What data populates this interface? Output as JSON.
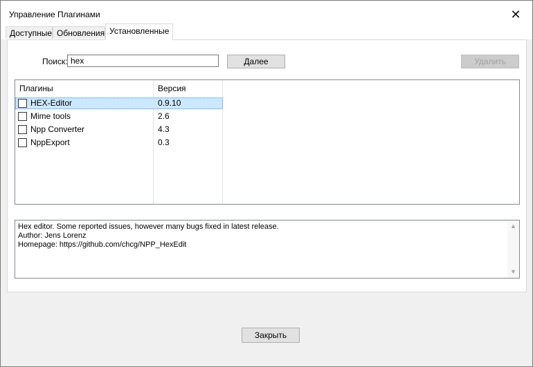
{
  "window": {
    "title": "Управление Плагинами",
    "close_glyph": "✕"
  },
  "tabs": [
    {
      "label": "Доступные",
      "active": false
    },
    {
      "label": "Обновления",
      "active": false
    },
    {
      "label": "Установленные",
      "active": true
    }
  ],
  "search": {
    "label": "Поиск:",
    "value": "hex"
  },
  "buttons": {
    "next": "Далее",
    "remove": "Удалить",
    "close": "Закрыть"
  },
  "plugins": {
    "columns": [
      "Плагины",
      "Версия"
    ],
    "rows": [
      {
        "name": "HEX-Editor",
        "version": "0.9.10",
        "checked": false,
        "selected": true
      },
      {
        "name": "Mime tools",
        "version": "2.6",
        "checked": false,
        "selected": false
      },
      {
        "name": "Npp Converter",
        "version": "4.3",
        "checked": false,
        "selected": false
      },
      {
        "name": "NppExport",
        "version": "0.3",
        "checked": false,
        "selected": false
      }
    ]
  },
  "description": {
    "lines": [
      "Hex editor. Some reported issues, however many bugs fixed in latest release.",
      "Author: Jens Lorenz",
      "Homepage: https://github.com/chcg/NPP_HexEdit"
    ]
  },
  "colors": {
    "selection": "#cce8ff",
    "window_bg": "#f0f0f0"
  }
}
